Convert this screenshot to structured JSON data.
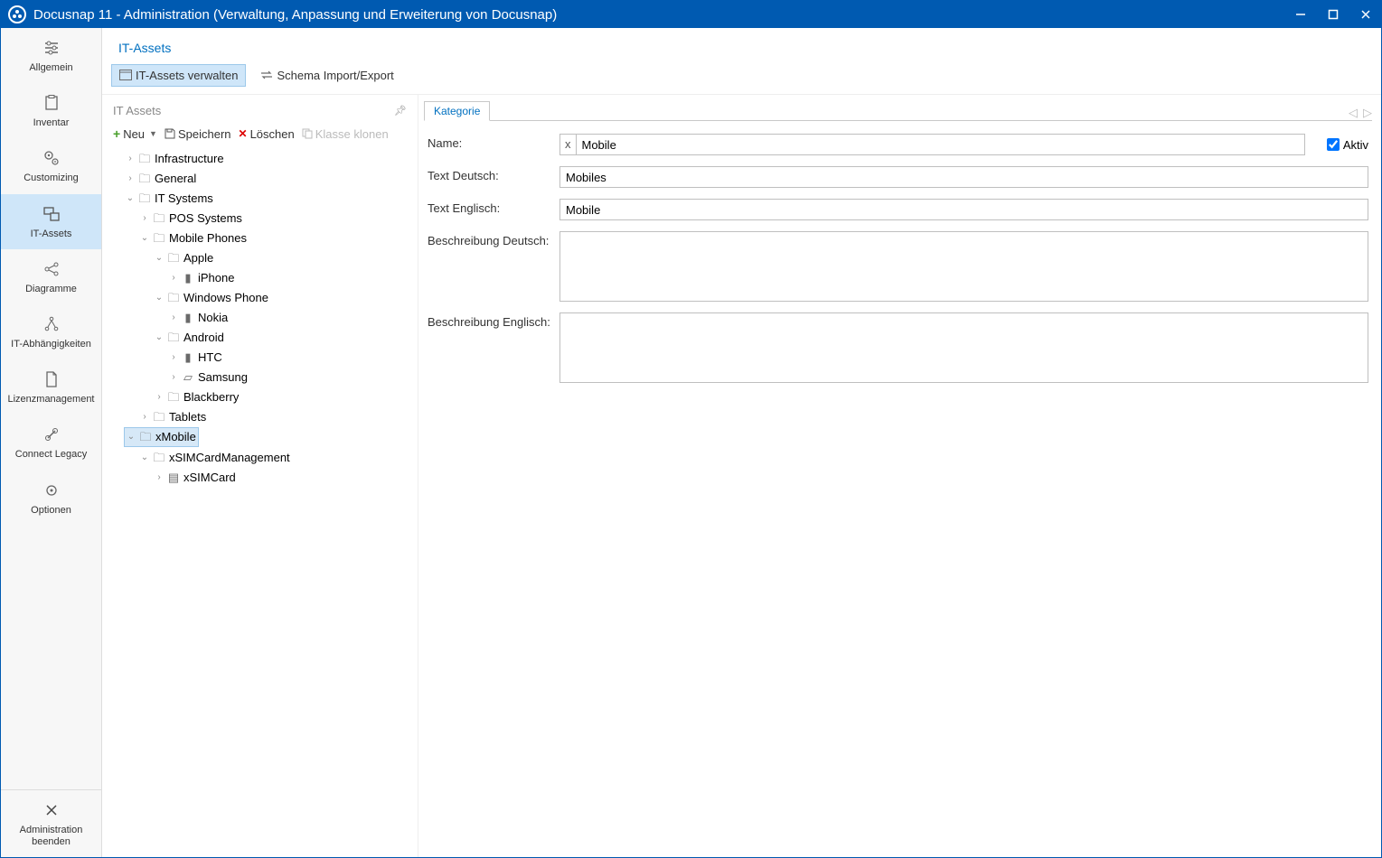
{
  "window": {
    "title": "Docusnap 11 - Administration (Verwaltung, Anpassung und Erweiterung von Docusnap)"
  },
  "sidebar": {
    "items": [
      {
        "label": "Allgemein"
      },
      {
        "label": "Inventar"
      },
      {
        "label": "Customizing"
      },
      {
        "label": "IT-Assets"
      },
      {
        "label": "Diagramme"
      },
      {
        "label": "IT-Abhängigkeiten"
      },
      {
        "label": "Lizenzmanagement"
      },
      {
        "label": "Connect Legacy"
      },
      {
        "label": "Optionen"
      }
    ],
    "exit_label": "Administration beenden"
  },
  "page": {
    "title": "IT-Assets"
  },
  "subnav": {
    "manage": "IT-Assets verwalten",
    "schema": "Schema Import/Export"
  },
  "treepanel": {
    "header": "IT Assets"
  },
  "toolbar": {
    "new_label": "Neu",
    "save_label": "Speichern",
    "delete_label": "Löschen",
    "clone_label": "Klasse klonen"
  },
  "tree": {
    "infrastructure": "Infrastructure",
    "general": "General",
    "itsystems": "IT Systems",
    "pos": "POS Systems",
    "mobilephones": "Mobile Phones",
    "apple": "Apple",
    "iphone": "iPhone",
    "winphone": "Windows Phone",
    "nokia": "Nokia",
    "android": "Android",
    "htc": "HTC",
    "samsung": "Samsung",
    "blackberry": "Blackberry",
    "tablets": "Tablets",
    "xmobile": "xMobile",
    "xsimcardmgmt": "xSIMCardManagement",
    "xsimcard": "xSIMCard"
  },
  "formpanel": {
    "tab": "Kategorie",
    "labels": {
      "name": "Name:",
      "text_de": "Text Deutsch:",
      "text_en": "Text Englisch:",
      "desc_de": "Beschreibung Deutsch:",
      "desc_en": "Beschreibung Englisch:",
      "aktiv": "Aktiv"
    },
    "values": {
      "name_prefix": "x",
      "name": "Mobile",
      "text_de": "Mobiles",
      "text_en": "Mobile",
      "desc_de": "",
      "desc_en": "",
      "aktiv_checked": true
    }
  }
}
